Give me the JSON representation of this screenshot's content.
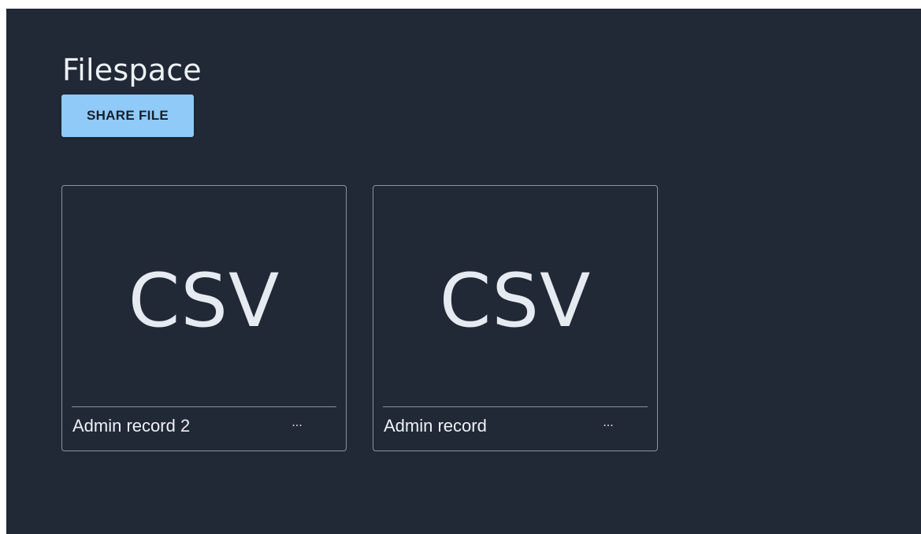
{
  "page": {
    "title": "Filespace",
    "share_button_label": "SHARE FILE"
  },
  "colors": {
    "background": "#212836",
    "accent_button": "#8fcaf8",
    "card_border": "#8b93a0",
    "text": "#eef1f6"
  },
  "files": [
    {
      "type": "CSV",
      "name": "Admin record 2",
      "more_label": "···",
      "more_icon": "more-horizontal-icon"
    },
    {
      "type": "CSV",
      "name": "Admin record",
      "more_label": "···",
      "more_icon": "more-horizontal-icon"
    }
  ]
}
